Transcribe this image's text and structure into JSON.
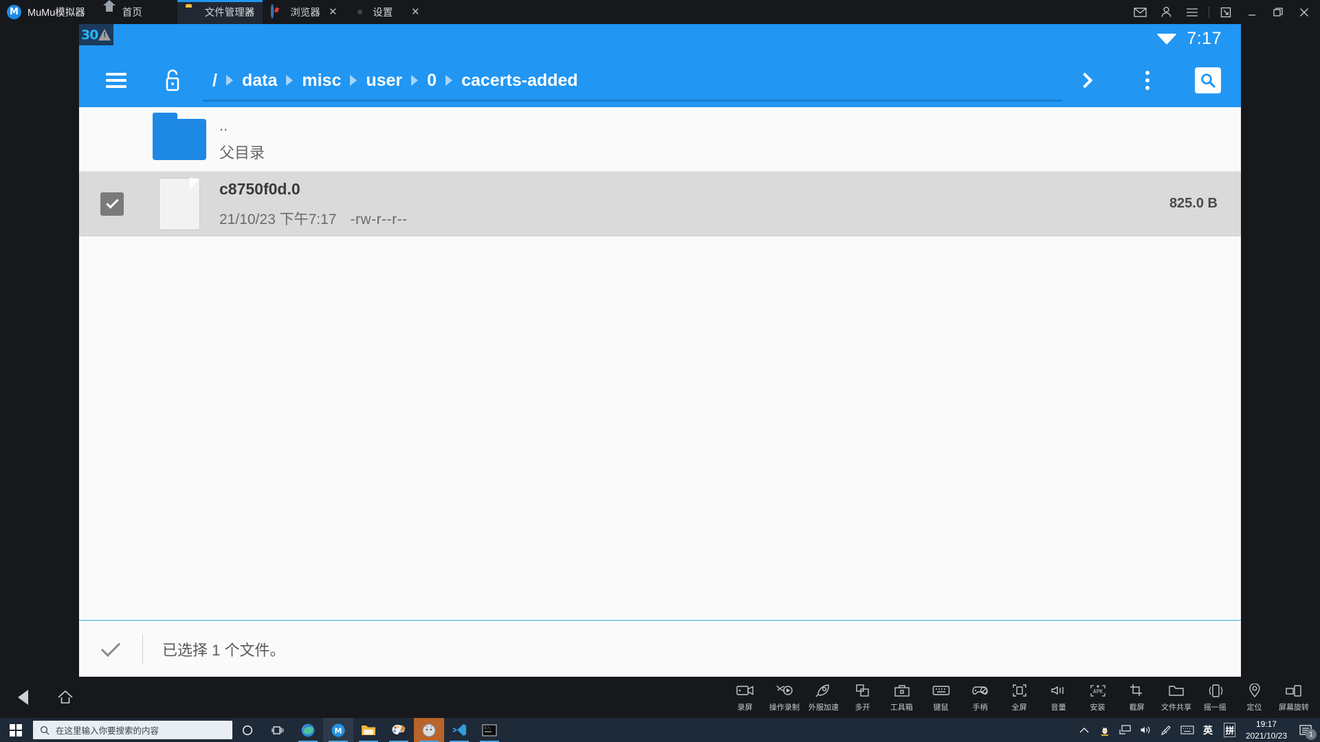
{
  "window": {
    "app_name": "MuMu模拟器",
    "logo_glyph": "M",
    "tabs": [
      {
        "label": "首页",
        "icon": "home-icon",
        "closable": false,
        "active": false
      },
      {
        "label": "文件管理器",
        "icon": "folder-icon",
        "closable": true,
        "active": true
      },
      {
        "label": "浏览器",
        "icon": "compass-icon",
        "closable": true,
        "active": false
      },
      {
        "label": "设置",
        "icon": "gear-icon",
        "closable": true,
        "active": false
      }
    ],
    "close_glyph": "✕",
    "controls": [
      {
        "name": "mail-icon",
        "glyph": "✉"
      },
      {
        "name": "account-icon",
        "glyph": "👤"
      },
      {
        "name": "menu-icon",
        "glyph": "☰"
      },
      {
        "name": "restore-window-icon",
        "glyph": "⬊"
      },
      {
        "name": "minimize-icon",
        "glyph": "—"
      },
      {
        "name": "maximize-icon",
        "glyph": "❐"
      },
      {
        "name": "close-window-icon",
        "glyph": "✕"
      }
    ]
  },
  "android": {
    "status_bar": {
      "fps": "30",
      "time": "7:17",
      "wifi": "wifi-icon"
    },
    "toolbar": {
      "menu": "hamburger-icon",
      "lock": "unlock-icon",
      "breadcrumbs": [
        "/",
        "data",
        "misc",
        "user",
        "0",
        "cacerts-added"
      ],
      "forward": "chevron-right-icon",
      "overflow": "more-vertical-icon",
      "search": "search-icon"
    },
    "files": [
      {
        "name": "..",
        "subtitle": "父目录",
        "type": "folder",
        "selected": false,
        "size": "",
        "perm": ""
      },
      {
        "name": "c8750f0d.0",
        "date": "21/10/23 下午7:17",
        "perm": "-rw-r--r--",
        "size": "825.0 B",
        "type": "file",
        "selected": true
      }
    ],
    "status": {
      "check": "check-icon",
      "message": "已选择 1 个文件。"
    }
  },
  "emulator_bar": {
    "nav": [
      {
        "name": "back-button",
        "label": ""
      },
      {
        "name": "home-button",
        "label": ""
      }
    ],
    "tools": [
      {
        "label": "录屏",
        "icon": "record-screen-icon"
      },
      {
        "label": "操作录制",
        "icon": "macro-record-icon"
      },
      {
        "label": "外服加速",
        "icon": "rocket-accel-icon"
      },
      {
        "label": "多开",
        "icon": "multi-instance-icon"
      },
      {
        "label": "工具箱",
        "icon": "toolbox-icon"
      },
      {
        "label": "键鼠",
        "icon": "keyboard-mouse-icon"
      },
      {
        "label": "手柄",
        "icon": "gamepad-icon"
      },
      {
        "label": "全屏",
        "icon": "fullscreen-icon"
      },
      {
        "label": "音量",
        "icon": "volume-icon"
      },
      {
        "label": "安装",
        "icon": "install-apk-icon"
      },
      {
        "label": "截屏",
        "icon": "screenshot-icon"
      },
      {
        "label": "文件共享",
        "icon": "file-share-icon"
      },
      {
        "label": "摇一摇",
        "icon": "shake-icon"
      },
      {
        "label": "定位",
        "icon": "location-icon"
      },
      {
        "label": "屏幕旋转",
        "icon": "rotate-screen-icon"
      }
    ]
  },
  "taskbar": {
    "start": "windows-start-icon",
    "search_placeholder": "在这里输入你要搜索的内容",
    "search_icon": "search-icon",
    "items": [
      {
        "name": "cortana-icon"
      },
      {
        "name": "task-view-icon"
      },
      {
        "name": "edge-icon"
      },
      {
        "name": "mumu-icon"
      },
      {
        "name": "file-explorer-icon"
      },
      {
        "name": "paint-icon"
      },
      {
        "name": "app-orange-icon"
      },
      {
        "name": "vscode-icon"
      },
      {
        "name": "terminal-icon"
      }
    ],
    "tray": {
      "expand": "chevron-up-icon",
      "qq": "qq-icon",
      "network": "network-icon",
      "volume": "volume-icon",
      "pen": "pen-icon",
      "keyboard": "keyboard-icon",
      "ime_lang": "英",
      "ime_mode": "拼",
      "time": "19:17",
      "date": "2021/10/23",
      "notification_count": "1"
    }
  }
}
